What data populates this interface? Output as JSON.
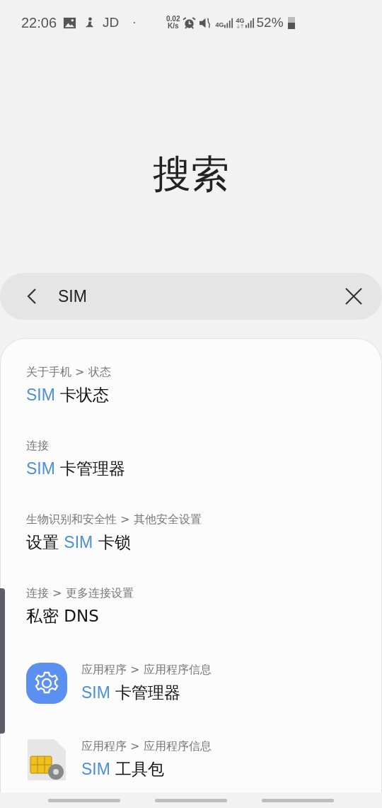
{
  "status_bar": {
    "time": "22:06",
    "app_label": "JD",
    "dot": "·",
    "speed_value": "0.02",
    "speed_unit": "K/s",
    "sim1_type": "4G",
    "sim2_type": "4G",
    "battery": "52%"
  },
  "header": {
    "title": "搜索"
  },
  "search": {
    "value": "SIM"
  },
  "results": [
    {
      "kind": "plain",
      "path": "关于手机 > 状态",
      "title": [
        {
          "text": "SIM",
          "match": true
        },
        {
          "text": " 卡状态",
          "match": false
        }
      ]
    },
    {
      "kind": "plain",
      "path": "连接",
      "title": [
        {
          "text": "SIM",
          "match": true
        },
        {
          "text": " 卡管理器",
          "match": false
        }
      ]
    },
    {
      "kind": "plain",
      "path": "生物识别和安全性 > 其他安全设置",
      "title": [
        {
          "text": "设置 ",
          "match": false
        },
        {
          "text": "SIM",
          "match": true
        },
        {
          "text": " 卡锁",
          "match": false
        }
      ]
    },
    {
      "kind": "plain",
      "path": "连接 > 更多连接设置",
      "title": [
        {
          "text": "私密 DNS",
          "match": false
        }
      ]
    },
    {
      "kind": "settings_app",
      "path": "应用程序 > 应用程序信息",
      "title": [
        {
          "text": "SIM",
          "match": true
        },
        {
          "text": " 卡管理器",
          "match": false
        }
      ]
    },
    {
      "kind": "sim_app",
      "path": "应用程序 > 应用程序信息",
      "title": [
        {
          "text": "SIM",
          "match": true
        },
        {
          "text": " 工具包",
          "match": false
        }
      ]
    }
  ]
}
